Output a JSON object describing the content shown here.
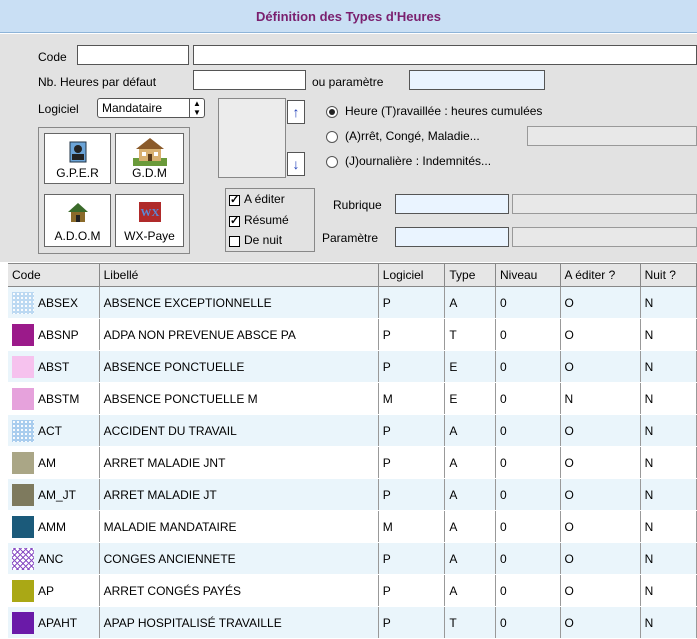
{
  "window": {
    "title": "Définition des Types d'Heures"
  },
  "form": {
    "code_label": "Code",
    "code_value": "",
    "nb_heures_label": "Nb. Heures par défaut",
    "ou_parametre_label": "ou paramètre",
    "logiciel_label": "Logiciel",
    "logiciel_value": "Mandataire",
    "radio_options": [
      {
        "label": "Heure (T)ravaillée : heures cumulées",
        "selected": true
      },
      {
        "label": "(A)rrêt, Congé, Maladie...",
        "selected": false
      },
      {
        "label": "(J)ournalière : Indemnités...",
        "selected": false
      }
    ],
    "rubrique_label": "Rubrique",
    "parametre_label": "Paramètre",
    "checkboxes": [
      {
        "label": "A éditer",
        "checked": true
      },
      {
        "label": "Résumé",
        "checked": true
      },
      {
        "label": "De nuit",
        "checked": false
      }
    ]
  },
  "apps": [
    {
      "label": "G.P.E.R",
      "icon": "person-badge-icon"
    },
    {
      "label": "G.D.M",
      "icon": "house-icon"
    },
    {
      "label": "A.D.O.M",
      "icon": "small-house-icon"
    },
    {
      "label": "WX-Paye",
      "icon": "wx-logo-icon"
    }
  ],
  "table": {
    "columns": [
      "Code",
      "Libellé",
      "Logiciel",
      "Type",
      "Niveau",
      "A éditer ?",
      "Nuit ?"
    ],
    "rows": [
      {
        "code": "ABSEX",
        "libelle": "ABSENCE EXCEPTIONNELLE",
        "logiciel": "P",
        "type": "A",
        "niveau": "0",
        "editer": "O",
        "nuit": "N",
        "color": "#bcd9f2",
        "pattern": "dots"
      },
      {
        "code": "ABSNP",
        "libelle": "ADPA NON PREVENUE ABSCE PA",
        "logiciel": "P",
        "type": "T",
        "niveau": "0",
        "editer": "O",
        "nuit": "N",
        "color": "#9b1a8a",
        "pattern": "solid"
      },
      {
        "code": "ABST",
        "libelle": "ABSENCE PONCTUELLE",
        "logiciel": "P",
        "type": "E",
        "niveau": "0",
        "editer": "O",
        "nuit": "N",
        "color": "#f6c2ee",
        "pattern": "solid"
      },
      {
        "code": "ABSTM",
        "libelle": "ABSENCE PONCTUELLE M",
        "logiciel": "M",
        "type": "E",
        "niveau": "0",
        "editer": "N",
        "nuit": "N",
        "color": "#e6a2dc",
        "pattern": "solid"
      },
      {
        "code": "ACT",
        "libelle": "ACCIDENT DU TRAVAIL",
        "logiciel": "P",
        "type": "A",
        "niveau": "0",
        "editer": "O",
        "nuit": "N",
        "color": "#a9cdee",
        "pattern": "dots"
      },
      {
        "code": "AM",
        "libelle": "ARRET MALADIE JNT",
        "logiciel": "P",
        "type": "A",
        "niveau": "0",
        "editer": "O",
        "nuit": "N",
        "color": "#aaa686",
        "pattern": "solid"
      },
      {
        "code": "AM_JT",
        "libelle": "ARRET MALADIE JT",
        "logiciel": "P",
        "type": "A",
        "niveau": "0",
        "editer": "O",
        "nuit": "N",
        "color": "#7e7a5e",
        "pattern": "solid"
      },
      {
        "code": "AMM",
        "libelle": "MALADIE MANDATAIRE",
        "logiciel": "M",
        "type": "A",
        "niveau": "0",
        "editer": "O",
        "nuit": "N",
        "color": "#1b5a7a",
        "pattern": "solid"
      },
      {
        "code": "ANC",
        "libelle": "CONGES ANCIENNETE",
        "logiciel": "P",
        "type": "A",
        "niveau": "0",
        "editer": "O",
        "nuit": "N",
        "color": "#8a4fc4",
        "pattern": "cross"
      },
      {
        "code": "AP",
        "libelle": "ARRET CONGÉS PAYÉS",
        "logiciel": "P",
        "type": "A",
        "niveau": "0",
        "editer": "O",
        "nuit": "N",
        "color": "#aaa815",
        "pattern": "solid"
      },
      {
        "code": "APAHT",
        "libelle": "APAP HOSPITALISÉ TRAVAILLE",
        "logiciel": "P",
        "type": "T",
        "niveau": "0",
        "editer": "O",
        "nuit": "N",
        "color": "#6a1aa8",
        "pattern": "solid"
      }
    ]
  }
}
